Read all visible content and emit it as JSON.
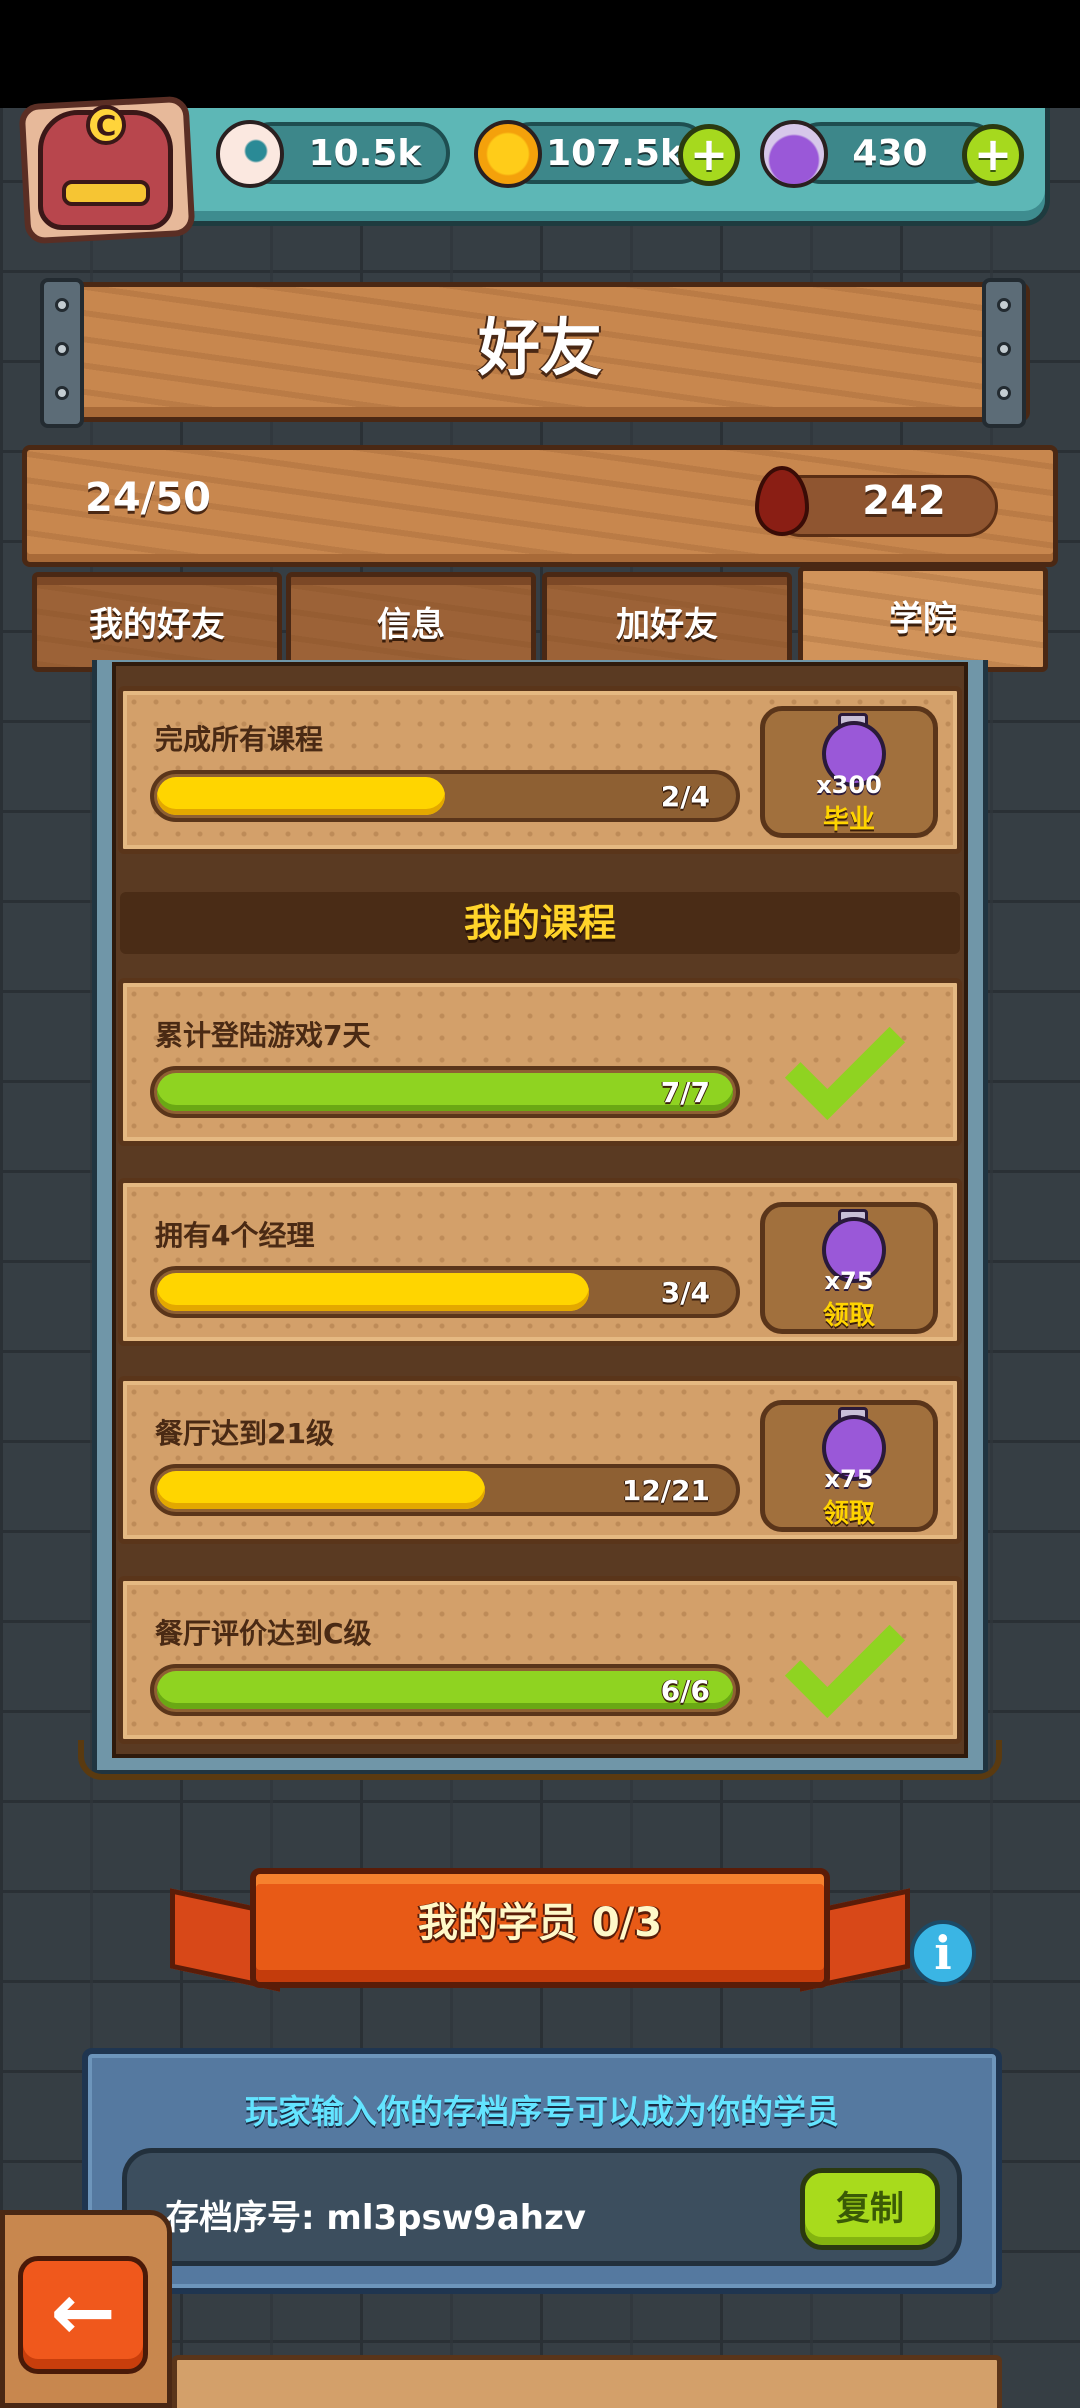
{
  "resources": [
    {
      "name": "eyeball",
      "value": "10.5k",
      "icon": "eyeball-icon",
      "has_plus": false
    },
    {
      "name": "coins",
      "value": "107.5k",
      "icon": "coin-icon",
      "has_plus": true
    },
    {
      "name": "potion",
      "value": "430",
      "icon": "potion-icon",
      "has_plus": true
    }
  ],
  "avatar_badge": "C",
  "title": "好友",
  "friends_count": "24/50",
  "blood_drops": "242",
  "tabs": [
    {
      "label": "我的好友",
      "active": false
    },
    {
      "label": "信息",
      "active": false
    },
    {
      "label": "加好友",
      "active": false
    },
    {
      "label": "学院",
      "active": true
    }
  ],
  "graduation": {
    "label": "完成所有课程",
    "progress": "2/4",
    "fraction": 0.5,
    "reward_qty": "x300",
    "reward_action": "毕业"
  },
  "courses_header": "我的课程",
  "courses": [
    {
      "label": "累计登陆游戏7天",
      "progress": "7/7",
      "fraction": 1.0,
      "done": true
    },
    {
      "label": "拥有4个经理",
      "progress": "3/4",
      "fraction": 0.75,
      "done": false,
      "reward_qty": "x75",
      "reward_action": "领取"
    },
    {
      "label": "餐厅达到21级",
      "progress": "12/21",
      "fraction": 0.57,
      "done": false,
      "reward_qty": "x75",
      "reward_action": "领取"
    },
    {
      "label": "餐厅评价达到C级",
      "progress": "6/6",
      "fraction": 1.0,
      "done": true
    }
  ],
  "students_banner": "我的学员 0/3",
  "invite_hint": "玩家输入你的存档序号可以成为你的学员",
  "save_code": "存档序号: ml3psw9ahzv",
  "copy_label": "复制",
  "colors": {
    "progress_yellow": "#ffd500",
    "progress_green": "#8fd321",
    "reward_text": "#ffd400",
    "hint_text": "#63e4ff"
  }
}
